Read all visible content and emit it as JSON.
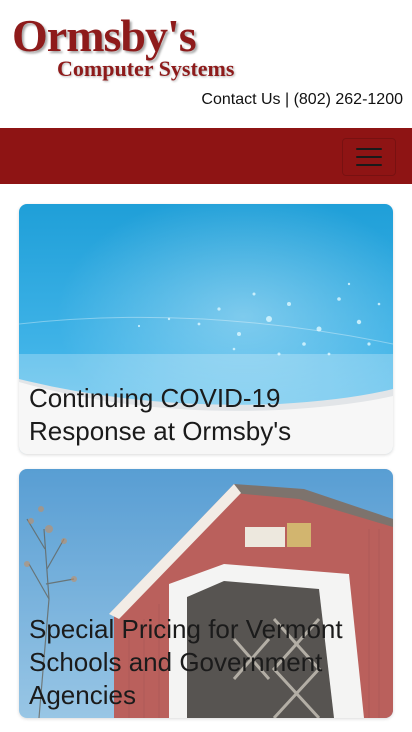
{
  "header": {
    "logo_main": "Ormsby's",
    "logo_sub": "Computer Systems",
    "contact": "Contact Us | (802) 262-1200"
  },
  "navbar": {
    "background": "#8e1414",
    "toggle_icon": "hamburger-icon"
  },
  "cards": [
    {
      "title": "Continuing COVID-19 Response at Ormsby's",
      "image": "blue-particles-background"
    },
    {
      "title": "Special Pricing for Vermont Schools and Government Agencies",
      "image": "covered-bridge-photo"
    }
  ],
  "colors": {
    "brand": "#8e1b1b",
    "navbar": "#8e1414"
  }
}
